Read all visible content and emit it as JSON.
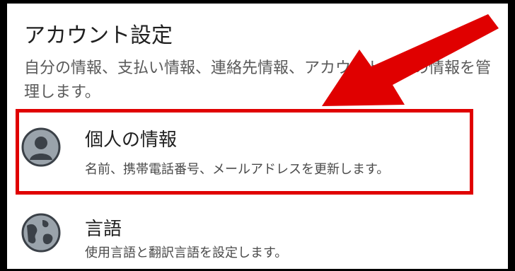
{
  "section": {
    "title": "アカウント設定",
    "description": "自分の情報、支払い情報、連絡先情報、アカウント全般の情報を管理します。"
  },
  "items": [
    {
      "title": "個人の情報",
      "subtitle": "名前、携帯電話番号、メールアドレスを更新します。",
      "icon": "person-icon"
    },
    {
      "title": "言語",
      "subtitle": "使用言語と翻訳言語を設定します。",
      "icon": "globe-icon"
    }
  ],
  "colors": {
    "highlight": "#e00000",
    "arrow": "#e00000",
    "icon_fill": "#9aa3ab",
    "icon_stroke": "#3b4148"
  }
}
